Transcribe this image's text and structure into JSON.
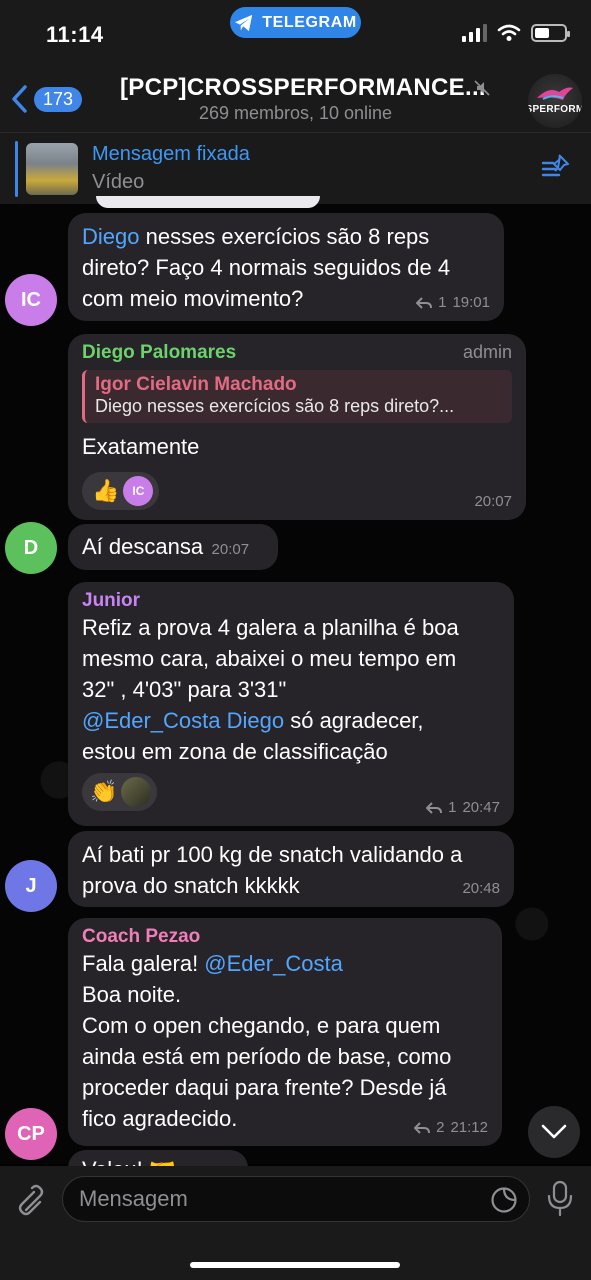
{
  "status_bar": {
    "time": "11:14",
    "app_pill": "TELEGRAM"
  },
  "header": {
    "back_count": "173",
    "title": "[PCP]CROSSPERFORMANCE...",
    "subtitle": "269 membros, 10 online",
    "avatar_text": "SPERFORM"
  },
  "pinned": {
    "title": "Mensagem fixada",
    "subtitle": "Vídeo"
  },
  "messages": {
    "m1": {
      "avatar_initials": "IC",
      "mention": "Diego",
      "text_line1": " nesses exercícios são 8 reps",
      "text_line2": "direto? Faço 4 normais seguidos de 4",
      "text_line3": "com meio movimento?",
      "reply_count": "1",
      "time": "19:01"
    },
    "m2": {
      "sender": "Diego Palomares",
      "role": "admin",
      "reply_name": "Igor Cielavin Machado",
      "reply_text": "Diego nesses exercícios são 8 reps direto?...",
      "text": "Exatamente",
      "reaction1_emoji": "👍",
      "reaction1_user": "IC",
      "time": "20:07"
    },
    "m3": {
      "avatar_initials": "D",
      "text": "Aí descansa",
      "time": "20:07"
    },
    "m4": {
      "sender": "Junior",
      "line1": "Refiz a prova 4 galera a planilha é boa",
      "line2": "mesmo cara,  abaixei o meu tempo em",
      "line3": "32\" , 4'03\" para 3'31\"",
      "mention": "@Eder_Costa Diego",
      "line4_rest": " só agradecer,",
      "line5": "estou em zona de classificação",
      "reaction_emoji": "👏",
      "reply_count": "1",
      "time": "20:47"
    },
    "m5": {
      "avatar_initials": "J",
      "line1": "Aí bati pr 100 kg de snatch validando a",
      "line2": "prova do snatch kkkkk",
      "time": "20:48"
    },
    "m6": {
      "sender": "Coach Pezao",
      "avatar_initials": "CP",
      "line1_pre": "Fala galera! ",
      "mention": "@Eder_Costa",
      "line2": "Boa noite.",
      "line3": "Com o open chegando, e para quem",
      "line4": "ainda está em período de base, como",
      "line5": "proceder daqui para frente? Desde já",
      "line6": "fico agradecido.",
      "reply_count": "2",
      "time": "21:12"
    },
    "m7_partial": "Valeu! 🤝"
  },
  "input": {
    "placeholder": "Mensagem"
  },
  "colors": {
    "accent": "#3f86e8",
    "bubble": "#262428",
    "sender_diego": "#6dd16d",
    "sender_junior": "#c685f2",
    "sender_coach": "#ef7fb8",
    "avatar_ic": "#c97de8",
    "avatar_d": "#5cc15c",
    "avatar_j": "#6f77e6",
    "avatar_cp": "#e064b6"
  }
}
